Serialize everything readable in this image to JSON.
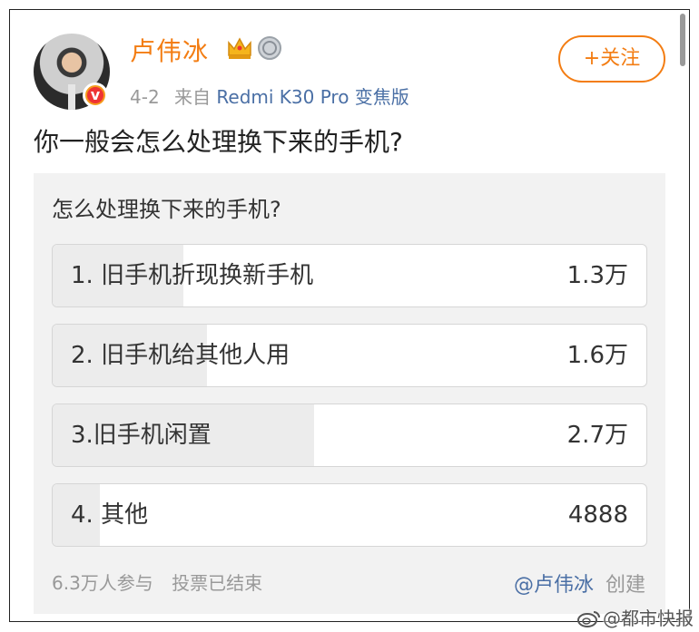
{
  "post": {
    "author": "卢伟冰",
    "date": "4-2",
    "source_prefix": "来自",
    "device": "Redmi K30 Pro 变焦版",
    "follow_label": "+关注",
    "verified_badge": "v",
    "text": "你一般会怎么处理换下来的手机?"
  },
  "poll": {
    "title": "怎么处理换下来的手机?",
    "options": [
      {
        "label": "1. 旧手机折现换新手机",
        "count": "1.3万",
        "fraction": 0.22
      },
      {
        "label": "2. 旧手机给其他人用",
        "count": "1.6万",
        "fraction": 0.26
      },
      {
        "label": "3.旧手机闲置",
        "count": "2.7万",
        "fraction": 0.44
      },
      {
        "label": "4. 其他",
        "count": "4888",
        "fraction": 0.08
      }
    ],
    "participants": "6.3万人参与",
    "status": "投票已结束",
    "creator": "@卢伟冰",
    "creator_suffix": "创建"
  },
  "watermark": "@都市快报",
  "colors": {
    "accent": "#f37d13",
    "link": "#4a6fa5",
    "poll_bg": "#f2f2f2",
    "bar_fill": "#ececec"
  },
  "icons": [
    "crown-icon",
    "medal-icon",
    "verified-icon",
    "weibo-icon"
  ]
}
